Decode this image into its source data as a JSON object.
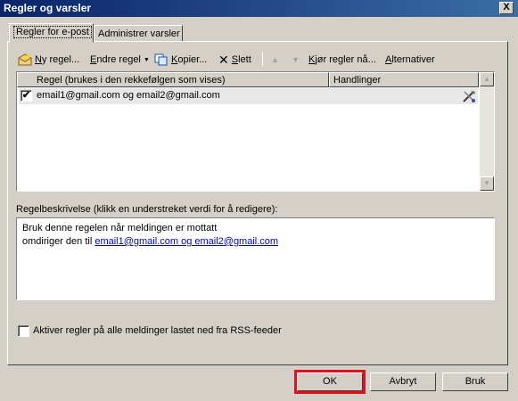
{
  "window": {
    "title": "Regler og varsler",
    "close_glyph": "X"
  },
  "tabs": [
    {
      "label": "Regler for e-post",
      "active": true
    },
    {
      "label": "Administrer varsler",
      "active": false
    }
  ],
  "toolbar": {
    "new_rule": "Ny regel...",
    "change_rule": "Endre regel",
    "copy": "Kopier...",
    "delete": "Slett",
    "run_rules": "Kjør regler nå...",
    "options": "Alternativer"
  },
  "rules_list": {
    "columns": [
      "Regel (brukes i den rekkefølgen som vises)",
      "Handlinger"
    ],
    "rows": [
      {
        "checked": true,
        "name": "email1@gmail.com og email2@gmail.com",
        "action_icon": "forward-rule-icon"
      }
    ]
  },
  "description": {
    "label": "Regelbeskrivelse (klikk en understreket verdi for å redigere):",
    "line1": "Bruk denne regelen når meldingen er mottatt",
    "line2_prefix": "omdiriger den til",
    "line2_link": "email1@gmail.com og email2@gmail.com"
  },
  "rss_option": {
    "checked": false,
    "label": "Aktiver regler på alle meldinger lastet ned fra RSS-feeder"
  },
  "buttons": {
    "ok": "OK",
    "cancel": "Avbryt",
    "apply": "Bruk"
  },
  "colors": {
    "title_bar": "#0a246a",
    "link": "#0000c0",
    "highlight": "#e01020"
  }
}
